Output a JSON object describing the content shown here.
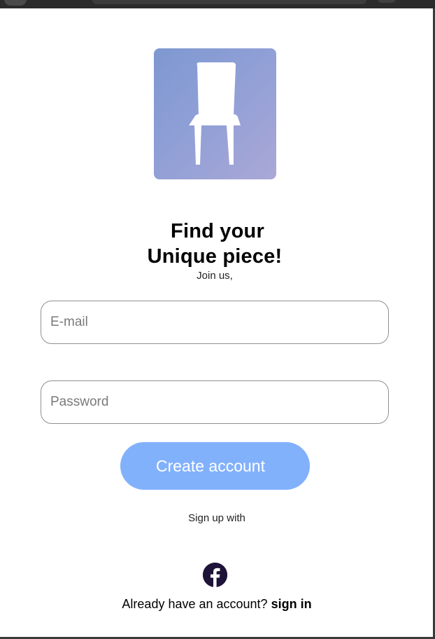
{
  "brand": {
    "logo_icon": "chair-icon",
    "logo_gradient_start": "#7e98d0",
    "logo_gradient_end": "#aaa8d6"
  },
  "headline": {
    "line1": "Find your",
    "line2": "Unique piece!"
  },
  "subtitle": "Join us,",
  "form": {
    "email": {
      "placeholder": "E-mail",
      "value": ""
    },
    "password": {
      "placeholder": "Password",
      "value": ""
    },
    "submit_label": "Create account"
  },
  "social": {
    "label": "Sign up with",
    "providers": [
      {
        "icon": "facebook-icon",
        "color": "#1e1339"
      }
    ]
  },
  "footer": {
    "prompt": "Already have an account?",
    "link": "sign in"
  },
  "colors": {
    "button": "#82b1fc",
    "button_text": "#ffffff",
    "field_border": "#8f8f8f"
  }
}
